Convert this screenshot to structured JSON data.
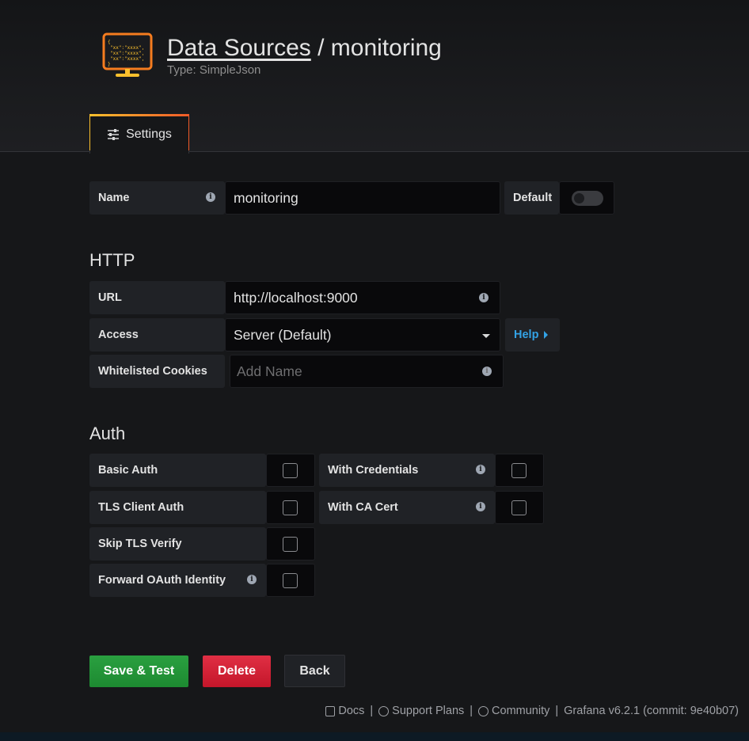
{
  "header": {
    "breadcrumb_link": "Data Sources",
    "breadcrumb_sep": " / ",
    "breadcrumb_current": "monitoring",
    "subtitle": "Type: SimpleJson",
    "logo_icon": "datasource-json-icon"
  },
  "tabs": [
    {
      "label": "Settings",
      "icon": "sliders-icon",
      "active": true
    }
  ],
  "name_row": {
    "label": "Name",
    "value": "monitoring",
    "default_label": "Default",
    "default_on": false
  },
  "http": {
    "title": "HTTP",
    "url_label": "URL",
    "url_value": "http://localhost:9000",
    "access_label": "Access",
    "access_value": "Server (Default)",
    "help_label": "Help",
    "cookies_label": "Whitelisted Cookies",
    "cookies_placeholder": "Add Name"
  },
  "auth": {
    "title": "Auth",
    "basic_auth": "Basic Auth",
    "tls_client_auth": "TLS Client Auth",
    "skip_tls_verify": "Skip TLS Verify",
    "forward_oauth": "Forward OAuth Identity",
    "with_credentials": "With Credentials",
    "with_ca_cert": "With CA Cert"
  },
  "actions": {
    "save": "Save & Test",
    "delete": "Delete",
    "back": "Back"
  },
  "footer": {
    "docs": "Docs",
    "support": "Support Plans",
    "community": "Community",
    "version": "Grafana v6.2.1 (commit: 9e40b07)"
  },
  "colors": {
    "accent_blue": "#33a2e5",
    "save_green": "#299c46",
    "delete_red": "#d44a3a",
    "tab_gradient_start": "#fbc02d",
    "tab_gradient_end": "#f05a28"
  }
}
